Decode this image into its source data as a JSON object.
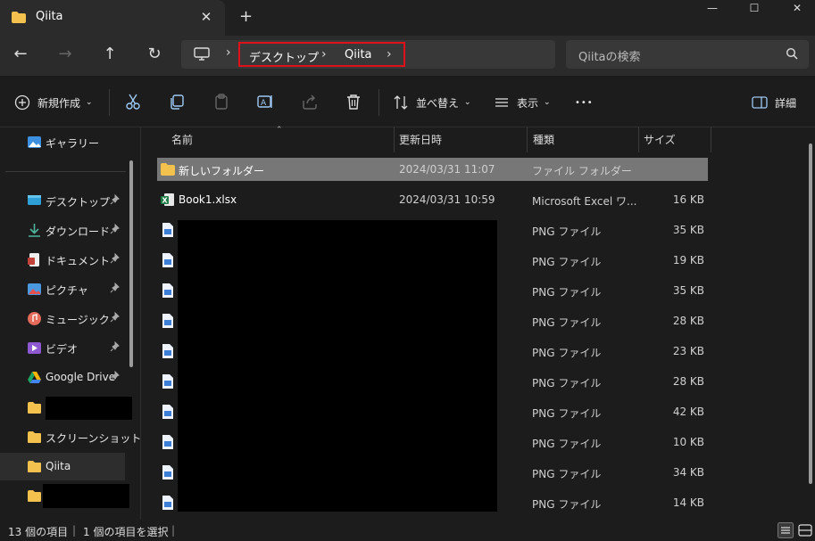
{
  "window": {
    "tab_title": "Qiita",
    "tab_close": "✕",
    "new_tab": "+",
    "minimize": "—",
    "maximize": "☐",
    "close": "✕"
  },
  "nav": {
    "back": "←",
    "forward": "→",
    "up": "↑",
    "refresh": "↻"
  },
  "breadcrumb": {
    "separator": "›",
    "items": [
      "デスクトップ",
      "Qiita"
    ],
    "highlight_color": "#e0101b"
  },
  "search": {
    "placeholder": "Qiitaの検索"
  },
  "toolbar": {
    "new_label": "新規作成",
    "sort_label": "並べ替え",
    "view_label": "表示",
    "more_label": "•••",
    "details_label": "詳細",
    "icons": [
      "cut-icon",
      "copy-icon",
      "paste-icon",
      "rename-icon",
      "share-icon",
      "delete-icon"
    ]
  },
  "sidebar": {
    "items": [
      {
        "label": "ギャラリー",
        "icon": "gallery-icon",
        "pinned": false
      },
      {
        "label": "デスクトップ",
        "icon": "desktop-icon",
        "pinned": true
      },
      {
        "label": "ダウンロード",
        "icon": "download-icon",
        "pinned": true
      },
      {
        "label": "ドキュメント",
        "icon": "documents-icon",
        "pinned": true
      },
      {
        "label": "ピクチャ",
        "icon": "pictures-icon",
        "pinned": true
      },
      {
        "label": "ミュージック",
        "icon": "music-icon",
        "pinned": true
      },
      {
        "label": "ビデオ",
        "icon": "video-icon",
        "pinned": true
      },
      {
        "label": "Google Drive",
        "icon": "google-drive-icon",
        "pinned": true
      },
      {
        "label": "",
        "icon": "folder-icon",
        "pinned": false
      },
      {
        "label": "スクリーンショット",
        "icon": "folder-icon",
        "pinned": false
      },
      {
        "label": "Qiita",
        "icon": "folder-icon",
        "pinned": false,
        "selected": true
      },
      {
        "label": "",
        "icon": "folder-icon",
        "pinned": false
      }
    ]
  },
  "columns": {
    "name": "名前",
    "date": "更新日時",
    "type": "種類",
    "size": "サイズ"
  },
  "files": [
    {
      "name": "新しいフォルダー",
      "date": "2024/03/31 11:07",
      "type": "ファイル フォルダー",
      "size": "",
      "icon": "folder-icon",
      "selected": true
    },
    {
      "name": "Book1.xlsx",
      "date": "2024/03/31 10:59",
      "type": "Microsoft Excel ワ...",
      "size": "16 KB",
      "icon": "excel-file-icon"
    },
    {
      "name": "",
      "date": "",
      "type": "PNG ファイル",
      "size": "35 KB",
      "icon": "png-file-icon"
    },
    {
      "name": "",
      "date": "",
      "type": "PNG ファイル",
      "size": "19 KB",
      "icon": "png-file-icon"
    },
    {
      "name": "",
      "date": "",
      "type": "PNG ファイル",
      "size": "35 KB",
      "icon": "png-file-icon"
    },
    {
      "name": "",
      "date": "",
      "type": "PNG ファイル",
      "size": "28 KB",
      "icon": "png-file-icon"
    },
    {
      "name": "",
      "date": "",
      "type": "PNG ファイル",
      "size": "23 KB",
      "icon": "png-file-icon"
    },
    {
      "name": "",
      "date": "",
      "type": "PNG ファイル",
      "size": "28 KB",
      "icon": "png-file-icon"
    },
    {
      "name": "",
      "date": "",
      "type": "PNG ファイル",
      "size": "42 KB",
      "icon": "png-file-icon"
    },
    {
      "name": "",
      "date": "",
      "type": "PNG ファイル",
      "size": "10 KB",
      "icon": "png-file-icon"
    },
    {
      "name": "",
      "date": "",
      "type": "PNG ファイル",
      "size": "34 KB",
      "icon": "png-file-icon"
    },
    {
      "name": "",
      "date": "",
      "type": "PNG ファイル",
      "size": "14 KB",
      "icon": "png-file-icon"
    }
  ],
  "status": {
    "item_count": "13 個の項目",
    "selection": "1 個の項目を選択"
  },
  "colors": {
    "background": "#1c1c1c",
    "selection": "#777777",
    "folder": "#f2c14e",
    "highlight": "#e0101b"
  }
}
